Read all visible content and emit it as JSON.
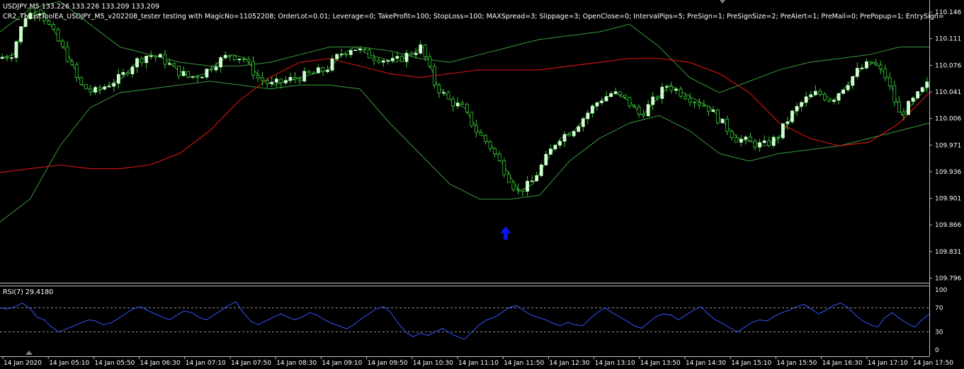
{
  "header": {
    "symbol_line": "USDJPY,M5  133.226 133.226 133.209 133.209",
    "ea_line": "CR2_ThrustToolEA_USDJPY_M5_v202208_tester testing with MagicNo=11052208; OrderLot=0.01; Leverage=0; TakeProfit=100; StopLoss=100; MAXSpread=3; Slippage=3; OpenClose=0; IntervalPips=5; PreSign=1; PreSignSize=2; PreAlert=1; PreMail=0; PrePopup=1; EntrySign="
  },
  "colors": {
    "background": "#000000",
    "bull_candle": "#ccffcc",
    "wick": "#33cc33",
    "bollinger": "#3a9a3a",
    "moving_average": "#cc1111",
    "rsi_line": "#3355ff",
    "arrow": "#0a14e6",
    "text": "#ffffff"
  },
  "chart_data": [
    {
      "type": "candlestick",
      "name": "USDJPY,M5",
      "price_axis": {
        "ticks": [
          "110.146",
          "110.111",
          "110.076",
          "110.041",
          "110.006",
          "109.971",
          "109.936",
          "109.901",
          "109.866",
          "109.831",
          "109.796"
        ],
        "ylim": [
          109.79,
          110.16
        ]
      },
      "time_axis": {
        "ticks": [
          "14 Jan 2020",
          "14 Jan 05:10",
          "14 Jan 05:50",
          "14 Jan 06:30",
          "14 Jan 07:10",
          "14 Jan 07:50",
          "14 Jan 08:30",
          "14 Jan 09:10",
          "14 Jan 09:50",
          "14 Jan 10:30",
          "14 Jan 11:10",
          "14 Jan 11:50",
          "14 Jan 12:30",
          "14 Jan 13:10",
          "14 Jan 13:50",
          "14 Jan 14:30",
          "14 Jan 15:10",
          "14 Jan 15:50",
          "14 Jan 16:30",
          "14 Jan 17:10",
          "14 Jan 17:50"
        ]
      },
      "close_path": [
        110.085,
        110.09,
        110.14,
        110.15,
        110.12,
        110.09,
        110.05,
        110.04,
        110.05,
        110.06,
        110.08,
        110.09,
        110.085,
        110.07,
        110.06,
        110.065,
        110.08,
        110.09,
        110.085,
        110.06,
        110.05,
        110.055,
        110.06,
        110.065,
        110.07,
        110.09,
        110.1,
        110.09,
        110.085,
        110.08,
        110.09,
        110.1,
        110.05,
        110.03,
        110.02,
        109.99,
        109.97,
        109.94,
        109.91,
        109.92,
        109.95,
        109.98,
        109.99,
        110.01,
        110.03,
        110.04,
        110.03,
        110.01,
        110.03,
        110.05,
        110.04,
        110.03,
        110.02,
        110.0,
        109.98,
        109.975,
        109.97,
        109.98,
        110.01,
        110.03,
        110.04,
        110.03,
        110.05,
        110.07,
        110.08,
        110.06,
        110.01,
        110.03,
        110.05
      ],
      "bollinger_upper": [
        110.12,
        110.15,
        110.16,
        110.13,
        110.1,
        110.09,
        110.08,
        110.075,
        110.075,
        110.08,
        110.09,
        110.1,
        110.1,
        110.095,
        110.085,
        110.08,
        110.09,
        110.1,
        110.11,
        110.115,
        110.12,
        110.13,
        110.1,
        110.06,
        110.04,
        110.055,
        110.07,
        110.08,
        110.085,
        110.09,
        110.1,
        110.1
      ],
      "bollinger_lower": [
        109.87,
        109.9,
        109.97,
        110.02,
        110.04,
        110.045,
        110.05,
        110.055,
        110.05,
        110.045,
        110.05,
        110.05,
        110.045,
        110.0,
        109.96,
        109.92,
        109.9,
        109.9,
        109.905,
        109.95,
        109.98,
        110.0,
        110.01,
        109.99,
        109.96,
        109.95,
        109.96,
        109.965,
        109.97,
        109.98,
        109.99,
        110.0
      ],
      "moving_average": [
        109.935,
        109.94,
        109.945,
        109.94,
        109.94,
        109.945,
        109.96,
        109.99,
        110.03,
        110.06,
        110.08,
        110.085,
        110.075,
        110.065,
        110.06,
        110.065,
        110.07,
        110.07,
        110.07,
        110.075,
        110.08,
        110.085,
        110.085,
        110.08,
        110.065,
        110.04,
        110.0,
        109.98,
        109.97,
        109.975,
        110.0,
        110.04
      ],
      "entry_signal": {
        "kind": "buy-arrow",
        "time_index": 37,
        "price": 109.855
      }
    },
    {
      "type": "line",
      "name": "RSI(7) 29.4180",
      "ylim": [
        0,
        100
      ],
      "levels": [
        30,
        70
      ],
      "ticks": [
        "100",
        "70",
        "30",
        "0"
      ],
      "values": [
        70,
        68,
        72,
        78,
        70,
        55,
        50,
        38,
        30,
        35,
        40,
        45,
        50,
        48,
        42,
        45,
        52,
        60,
        68,
        72,
        66,
        60,
        55,
        50,
        58,
        65,
        62,
        54,
        50,
        58,
        66,
        74,
        80,
        62,
        48,
        42,
        48,
        54,
        60,
        55,
        50,
        55,
        62,
        58,
        50,
        44,
        40,
        35,
        42,
        52,
        60,
        68,
        72,
        62,
        44,
        30,
        22,
        28,
        24,
        30,
        36,
        28,
        22,
        18,
        30,
        42,
        50,
        54,
        62,
        70,
        74,
        66,
        58,
        54,
        50,
        44,
        40,
        46,
        42,
        40,
        52,
        62,
        70,
        62,
        55,
        48,
        40,
        36,
        46,
        56,
        60,
        58,
        50,
        58,
        66,
        72,
        60,
        50,
        44,
        36,
        30,
        38,
        46,
        50,
        48,
        56,
        62,
        66,
        72,
        76,
        68,
        60,
        66,
        74,
        78,
        70,
        58,
        48,
        42,
        38,
        54,
        62,
        52,
        44,
        38,
        50,
        60
      ]
    }
  ]
}
